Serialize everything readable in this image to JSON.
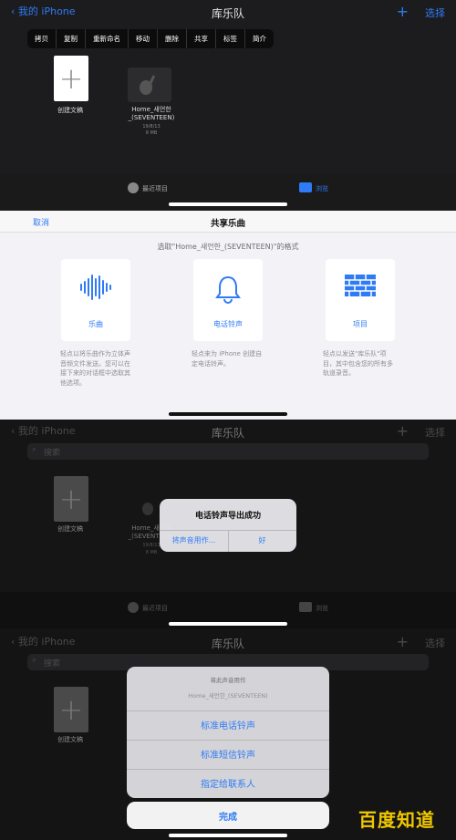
{
  "panel1": {
    "back_label": "我的 iPhone",
    "title": "库乐队",
    "plus": "+",
    "select_label": "选择",
    "menu": [
      "拷贝",
      "复制",
      "重新命名",
      "移动",
      "删除",
      "共享",
      "标签",
      "简介"
    ],
    "create_label": "创建文稿",
    "file_name": "Home_새언한\n_(SEVENTEEN)",
    "file_date": "19/8/13",
    "file_size": "8 MB",
    "tab_recent": "最近项目",
    "tab_browse": "浏览"
  },
  "panel2": {
    "cancel_label": "取消",
    "title": "共享乐曲",
    "subtitle": "选取\"Home_새언한_(SEVENTEEN)\"的格式",
    "options": [
      {
        "icon": "waveform-icon",
        "label": "乐曲",
        "desc": "轻点以将乐曲作为立体声音频文件发送。您可以在接下来的对话框中选取其他选项。"
      },
      {
        "icon": "bell-icon",
        "label": "电话铃声",
        "desc": "轻点来为 iPhone 创建自定电话铃声。"
      },
      {
        "icon": "brick-wall-icon",
        "label": "项目",
        "desc": "轻点以发送\"库乐队\"项目，其中包含您的所有多轨道录音。"
      }
    ]
  },
  "panel3": {
    "back_label": "我的 iPhone",
    "title": "库乐队",
    "plus": "+",
    "select_label": "选择",
    "search_placeholder": "搜索",
    "create_label": "创建文稿",
    "file_name": "Home_새언한\n_(SEVENTEEN)",
    "file_date": "19/8/13",
    "file_size": "8 MB",
    "tab_recent": "最近项目",
    "tab_browse": "浏览",
    "alert_title": "电话铃声导出成功",
    "alert_action": "将声音用作...",
    "alert_ok": "好"
  },
  "panel4": {
    "back_label": "我的 iPhone",
    "title": "库乐队",
    "plus": "+",
    "select_label": "选择",
    "search_placeholder": "搜索",
    "create_label": "创建文稿",
    "sheet_title": "将此声音用作",
    "sheet_file": "Home_새언한_(SEVENTEEN)",
    "actions": [
      "标准电话铃声",
      "标准短信铃声",
      "指定给联系人"
    ],
    "done_label": "完成",
    "watermark": "百度知道"
  },
  "colors": {
    "accent": "#2f7bf5",
    "dark": "#1c1c1e",
    "light": "#f2f2f7"
  }
}
